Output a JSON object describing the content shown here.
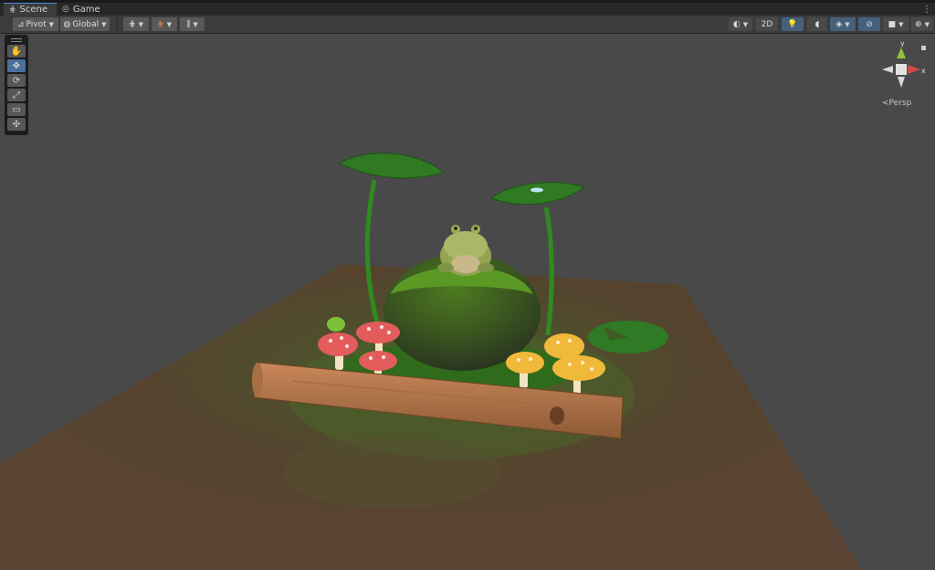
{
  "tabs": [
    {
      "label": "Scene",
      "icon": "grid-icon"
    },
    {
      "label": "Game",
      "icon": "gamepad-icon"
    }
  ],
  "toolbar": {
    "pivot_label": "Pivot",
    "global_label": "Global",
    "mode_2d_label": "2D"
  },
  "tools": [
    {
      "name": "hand-tool",
      "glyph": "✋"
    },
    {
      "name": "move-tool",
      "glyph": "✥"
    },
    {
      "name": "rotate-tool",
      "glyph": "⟳"
    },
    {
      "name": "scale-tool",
      "glyph": "⤢"
    },
    {
      "name": "rect-tool",
      "glyph": "▭"
    },
    {
      "name": "transform-tool",
      "glyph": "✣"
    }
  ],
  "gizmo": {
    "y_label": "y",
    "x_label": "x",
    "projection_label": "Persp"
  },
  "colors": {
    "active_tab_accent": "#4a8ee0",
    "selected_tool": "#4b6f9e",
    "gizmo_x": "#d24b43",
    "gizmo_y": "#8ec43c"
  }
}
